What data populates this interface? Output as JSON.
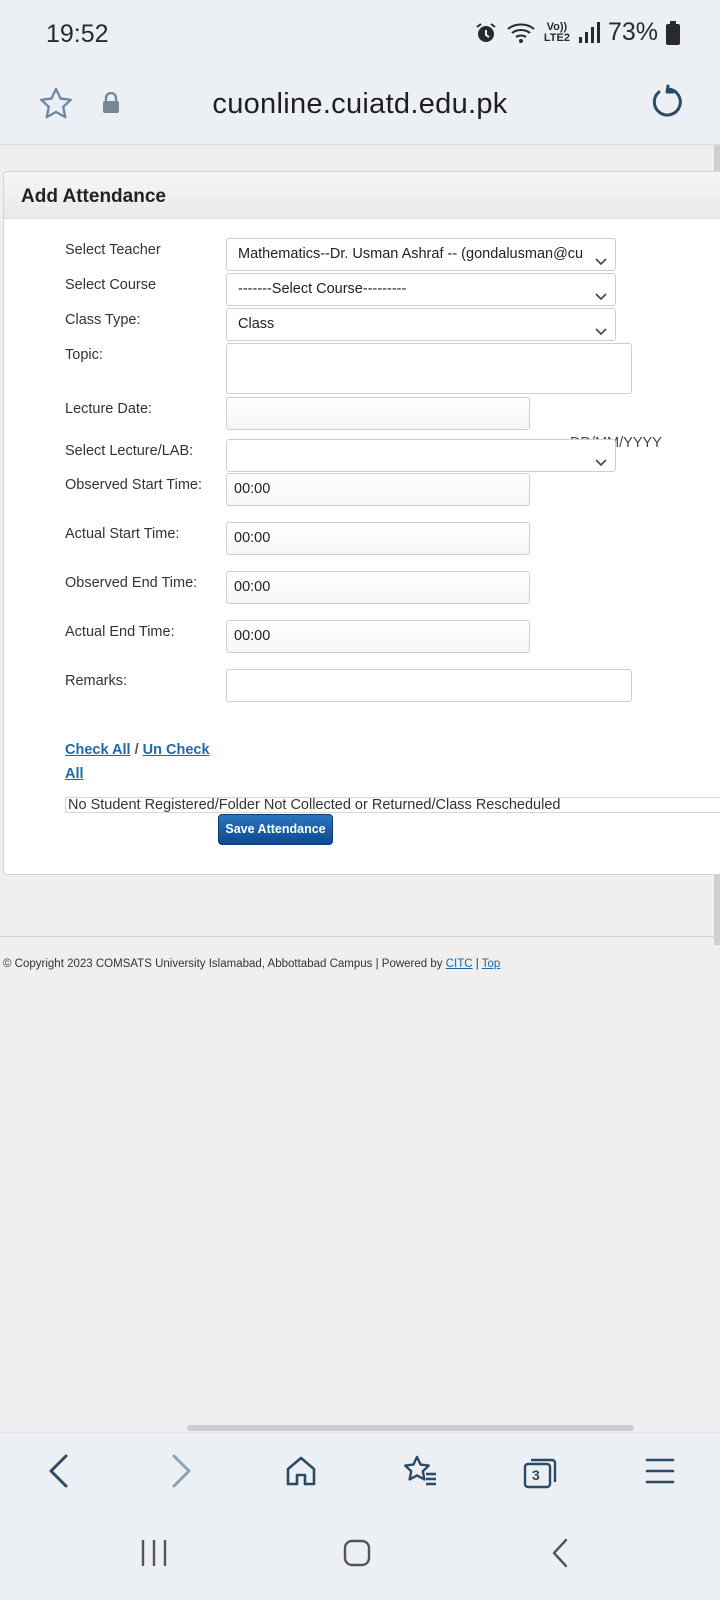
{
  "status_bar": {
    "time": "19:52",
    "network_label_top": "Vo))",
    "network_label_bottom": "LTE2",
    "battery": "73%"
  },
  "browser": {
    "url": "cuonline.cuiatd.edu.pk",
    "icons": [
      "star-icon",
      "lock-icon",
      "reload-icon"
    ]
  },
  "panel": {
    "title": "Add Attendance"
  },
  "form": {
    "teacher_label": "Select Teacher",
    "teacher_value": "Mathematics--Dr. Usman Ashraf -- (gondalusman@cu",
    "course_label": "Select Course",
    "course_value": "-------Select Course---------",
    "class_type_label": "Class Type:",
    "class_type_value": "Class",
    "topic_label": "Topic:",
    "topic_value": "",
    "lecture_date_label": "Lecture Date:",
    "lecture_date_value": "",
    "date_format": "DD/MM/YYYY",
    "lecture_lab_label": "Select Lecture/LAB:",
    "lecture_lab_value": "",
    "observed_start_label": "Observed Start Time:",
    "observed_start_value": "00:00",
    "actual_start_label": "Actual Start Time:",
    "actual_start_value": "00:00",
    "observed_end_label": "Observed End Time:",
    "observed_end_value": "00:00",
    "actual_end_label": "Actual End Time:",
    "actual_end_value": "00:00",
    "remarks_label": "Remarks:",
    "remarks_value": ""
  },
  "links": {
    "check_all": "Check All",
    "separator": " / ",
    "un_check_all": "Un Check All"
  },
  "notice": "No Student Registered/Folder Not Collected or Returned/Class Rescheduled",
  "save_button": "Save Attendance",
  "footer": {
    "copyright": "© Copyright 2023 COMSATS University Islamabad, Abbottabad Campus | Powered by ",
    "citc_link": "CITC",
    "separator": " | ",
    "top_link": "Top"
  },
  "toolbar": {
    "tab_count": "3",
    "icons": [
      "back-icon",
      "forward-icon",
      "home-icon",
      "bookmarks-icon",
      "tabs-icon",
      "menu-icon"
    ]
  },
  "colors": {
    "link": "#1a6aa8",
    "button": "#0b4a8c",
    "chrome": "#eceff3",
    "browser_icon": "#2b4a66"
  }
}
